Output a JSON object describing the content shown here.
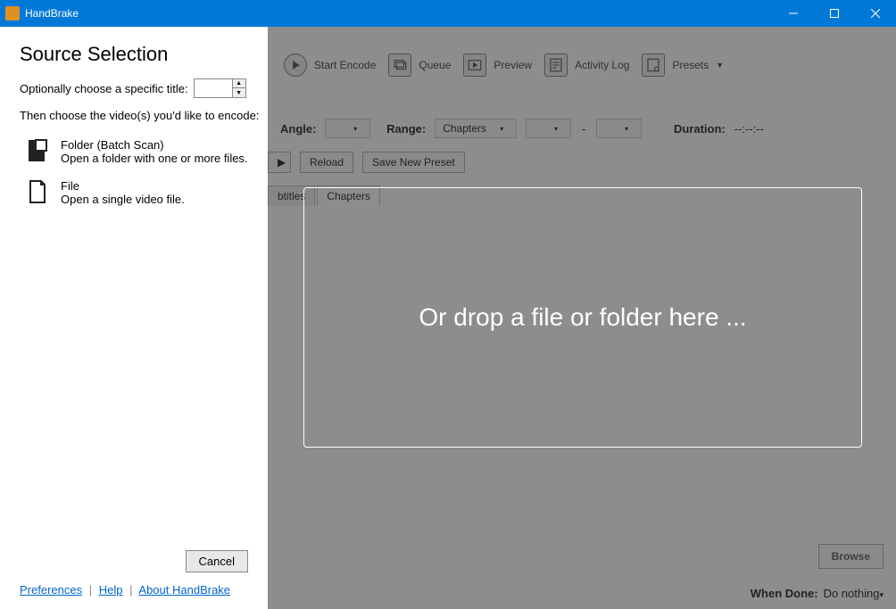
{
  "window": {
    "title": "HandBrake"
  },
  "toolbar": {
    "start_encode": "Start Encode",
    "queue": "Queue",
    "preview": "Preview",
    "activity_log": "Activity Log",
    "presets": "Presets"
  },
  "source_row": {
    "angle_label": "Angle:",
    "range_label": "Range:",
    "range_value": "Chapters",
    "dash": "-",
    "duration_label": "Duration:",
    "duration_value": "--:--:--"
  },
  "buttons": {
    "reload": "Reload",
    "save_preset": "Save New Preset"
  },
  "tabs": {
    "subtitles": "btitles",
    "chapters": "Chapters"
  },
  "browse": "Browse",
  "whendone": {
    "label": "When Done:",
    "value": "Do nothing"
  },
  "panel": {
    "title": "Source Selection",
    "opt_title_label": "Optionally choose a specific title:",
    "then_label": "Then choose the video(s) you'd like to encode:",
    "folder": {
      "title": "Folder (Batch Scan)",
      "desc": "Open a folder with one or more files."
    },
    "file": {
      "title": "File",
      "desc": "Open a single video file."
    },
    "cancel": "Cancel",
    "links": {
      "preferences": "Preferences",
      "help": "Help",
      "about": "About HandBrake"
    }
  },
  "dropzone": "Or drop a file or folder here ..."
}
